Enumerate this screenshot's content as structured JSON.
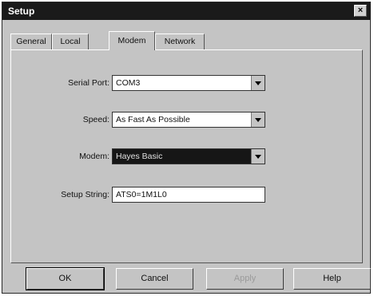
{
  "window": {
    "title": "Setup"
  },
  "titlebar": {
    "close_glyph": "×"
  },
  "tabs": [
    {
      "label": "General"
    },
    {
      "label": "Local"
    },
    {
      "label": "Modem"
    },
    {
      "label": "Network"
    }
  ],
  "active_tab": "Modem",
  "fields": {
    "serial_port": {
      "label": "Serial Port:",
      "value": "COM3"
    },
    "speed": {
      "label": "Speed:",
      "value": "As Fast As Possible"
    },
    "modem": {
      "label": "Modem:",
      "value": "Hayes Basic"
    },
    "setup_string": {
      "label": "Setup String:",
      "value": "ATS0=1M1L0"
    }
  },
  "buttons": {
    "ok": "OK",
    "cancel": "Cancel",
    "apply": "Apply",
    "help": "Help"
  }
}
